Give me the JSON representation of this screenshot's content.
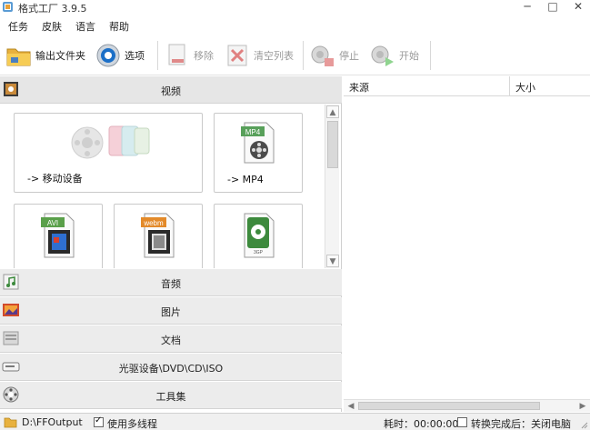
{
  "window": {
    "title": "格式工厂 3.9.5",
    "minimize": "─",
    "maximize": "□",
    "close": "✕"
  },
  "menu": [
    "任务",
    "皮肤",
    "语言",
    "帮助"
  ],
  "toolbar": {
    "output_folder": "输出文件夹",
    "options": "选项",
    "remove": "移除",
    "clear_list": "清空列表",
    "stop": "停止",
    "start": "开始"
  },
  "categories": {
    "video": "视频",
    "audio": "音频",
    "image": "图片",
    "document": "文档",
    "optical": "光驱设备\\DVD\\CD\\ISO",
    "tools": "工具集"
  },
  "video_tiles": [
    {
      "label": "-> 移动设备",
      "icon": "mobile-device-icon"
    },
    {
      "label": "-> MP4",
      "icon": "mp4-file-icon",
      "badge": "MP4"
    },
    {
      "label": "",
      "icon": "avi-file-icon",
      "badge": "AVI"
    },
    {
      "label": "",
      "icon": "webm-file-icon",
      "badge": "webm"
    },
    {
      "label": "",
      "icon": "3gp-file-icon",
      "badge": "3GP"
    }
  ],
  "task_list": {
    "columns": [
      "来源",
      "大小"
    ]
  },
  "status": {
    "output_path": "D:\\FFOutput",
    "multithread_label": "使用多线程",
    "multithread_checked": true,
    "elapsed_label": "耗时：00:00:00",
    "after_convert_label": "转换完成后：关闭电脑",
    "after_convert_checked": false
  }
}
